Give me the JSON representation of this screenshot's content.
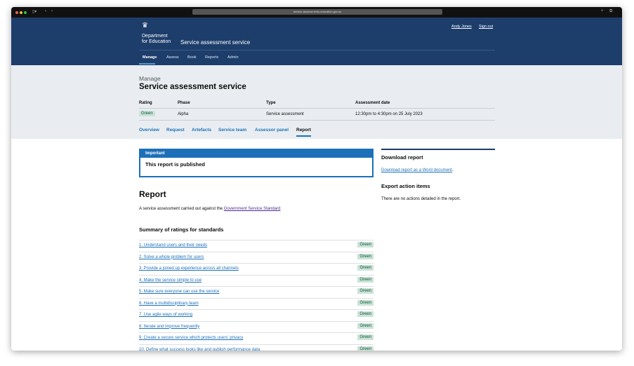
{
  "browser": {
    "url": "service-assessments.education.gov.uk"
  },
  "header": {
    "org_line1": "Department",
    "org_line2": "for Education",
    "service_name": "Service assessment service",
    "user": "Andy Jones",
    "sign_out": "Sign out",
    "nav": [
      "Manage",
      "Assess",
      "Book",
      "Reports",
      "Admin"
    ]
  },
  "summary": {
    "caption": "Manage",
    "title": "Service assessment service",
    "headers": [
      "Rating",
      "Phase",
      "Type",
      "Assessment date"
    ],
    "values": [
      "Green",
      "Alpha",
      "Service assessment",
      "12:30pm to 4:30pm on 25 July 2023"
    ]
  },
  "tabs": [
    "Overview",
    "Request",
    "Artefacts",
    "Service team",
    "Assessor panel",
    "Report"
  ],
  "notice": {
    "title": "Important",
    "body": "This report is published"
  },
  "report": {
    "heading": "Report",
    "intro": "A service assessment carried out against the ",
    "intro_link": "Government Service Standard",
    "summary_heading": "Summary of ratings for standards",
    "standards": [
      {
        "label": "1. Understand users and their needs",
        "rating": "Green"
      },
      {
        "label": "2. Solve a whole problem for users",
        "rating": "Green"
      },
      {
        "label": "3. Provide a joined up experience across all channels",
        "rating": "Green"
      },
      {
        "label": "4. Make the service simple to use",
        "rating": "Green"
      },
      {
        "label": "5. Make sure everyone can use the service",
        "rating": "Green"
      },
      {
        "label": "6. Have a multidisciplinary team",
        "rating": "Green"
      },
      {
        "label": "7. Use agile ways of working",
        "rating": "Green"
      },
      {
        "label": "8. Iterate and improve frequently",
        "rating": "Green"
      },
      {
        "label": "9. Create a secure service which protects users' privacy",
        "rating": "Green"
      },
      {
        "label": "10. Define what success looks like and publish performance data",
        "rating": "Green"
      }
    ]
  },
  "sidebar": {
    "download_heading": "Download report",
    "download_link": "Download report as a Word document",
    "download_suffix": ".",
    "export_heading": "Export action items",
    "export_text": "There are no actions detailed in the report."
  }
}
